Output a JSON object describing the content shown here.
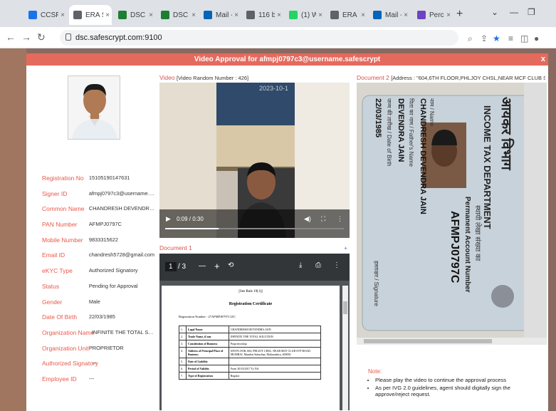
{
  "browser": {
    "tabs": [
      {
        "label": "CCSP T:",
        "color": "#1a73e8"
      },
      {
        "label": "ERA Se",
        "color": "#5f6368"
      },
      {
        "label": "DSC Tra",
        "color": "#1e7e34"
      },
      {
        "label": "DSC Tra",
        "color": "#1e7e34"
      },
      {
        "label": "Mail - 1",
        "color": "#0364b8"
      },
      {
        "label": "116 bi",
        "color": "#5f6368"
      },
      {
        "label": "(1) Wha",
        "color": "#25d366"
      },
      {
        "label": "ERA Se",
        "color": "#5f6368"
      },
      {
        "label": "Mail - 0",
        "color": "#0364b8"
      },
      {
        "label": "Percipi",
        "color": "#6f42c1"
      }
    ],
    "url": "dsc.safescrypt.com:9100"
  },
  "dialog": {
    "title": "Video Approval for afmpj0797c3@username.safescrypt",
    "close": "x"
  },
  "applicant": {
    "fields": [
      {
        "label": "Registration No",
        "value": "15105190147631"
      },
      {
        "label": "Signer ID",
        "value": "afmpj0797c3@username.safe..."
      },
      {
        "label": "Common Name",
        "value": "CHANDRESH DEVENDRA JAIN"
      },
      {
        "label": "PAN Number",
        "value": "AFMPJ0797C"
      },
      {
        "label": "Mobile Number",
        "value": "9833315622"
      },
      {
        "label": "Email ID",
        "value": "chandresh5728@gmail.com"
      },
      {
        "label": "eKYC Type",
        "value": "Authorized Signatory"
      },
      {
        "label": "Status",
        "value": "Pending for Approval"
      },
      {
        "label": "Gender",
        "value": "Male"
      },
      {
        "label": "Date Of Birth",
        "value": "22/03/1985"
      },
      {
        "label": "Organization Name",
        "value": "INFINITE THE TOTAL SOLUTION"
      },
      {
        "label": "Organization Unit",
        "value": "PROPRIETOR"
      },
      {
        "label": "Authorized Signatory",
        "value": "---"
      },
      {
        "label": "Employee ID",
        "value": "---"
      }
    ]
  },
  "video": {
    "heading": "Video",
    "random": "[Video Random Number : 426]",
    "time": "0:09 / 0:30",
    "stamp": "2023-10-1",
    "progress": 0.3
  },
  "document1": {
    "heading": "Document 1",
    "plus": "+",
    "page": "1",
    "of": "/ 3",
    "minus": "—",
    "zoomin": "+",
    "pdf": {
      "hdr": "[See Rule 19(1)]",
      "title": "Registration Certificate",
      "regno": "Registration Number : 27AFMPJ0797C1ZC",
      "rows": [
        [
          "1.",
          "Legal Name",
          "CHANDRESH DEVENDRA JAIN"
        ],
        [
          "2.",
          "Trade Name, if any",
          "INFINITE THE TOTAL SOLUTION"
        ],
        [
          "3.",
          "Constitution of Business",
          "Proprietorship"
        ],
        [
          "4.",
          "Address of Principal Place of Business",
          "6TH FLOOR, 604, PHLJOY CHSL, NEAR MCF CLUB SVP ROAD, MUMBAI, Mumbai Suburban, Maharashtra, 400092"
        ],
        [
          "5.",
          "Date of Liability",
          ""
        ],
        [
          "6.",
          "Period of Validity",
          "From 30/10/2017 To NA"
        ],
        [
          "7.",
          "Type of Registration",
          "Regular"
        ]
      ]
    }
  },
  "document2": {
    "heading": "Document 2",
    "address": "[Address : \"604,6TH FLOOR,PHLJOY CHSL,NEAR MCF CLUB SVP ROAD,MUMBAI...",
    "card": {
      "hindi_dept": "आयकर विभाग",
      "dept": "INCOME TAX DEPARTMENT",
      "pan_hi": "स्थायी लेखा संख्या का",
      "pan_label": "Permanent Account Number",
      "pan": "AFMPJ0797C",
      "name_label": "नाम / Name",
      "name": "CHANDRESH DEVENDRA JAIN",
      "father_label": "पिता का नाम / Father's Name",
      "father": "DEVENDRA JAIN",
      "dob_label": "जन्म की तारीख / Date of Birth",
      "dob": "22/03/1985",
      "sign": "हस्ताक्षर / Signature"
    }
  },
  "notes": {
    "title": "Note:",
    "items": [
      "Please play the video to continue the approval process",
      "As per IVG 2.0 guidelines, agent should digitally sign the approve/reject request."
    ]
  }
}
